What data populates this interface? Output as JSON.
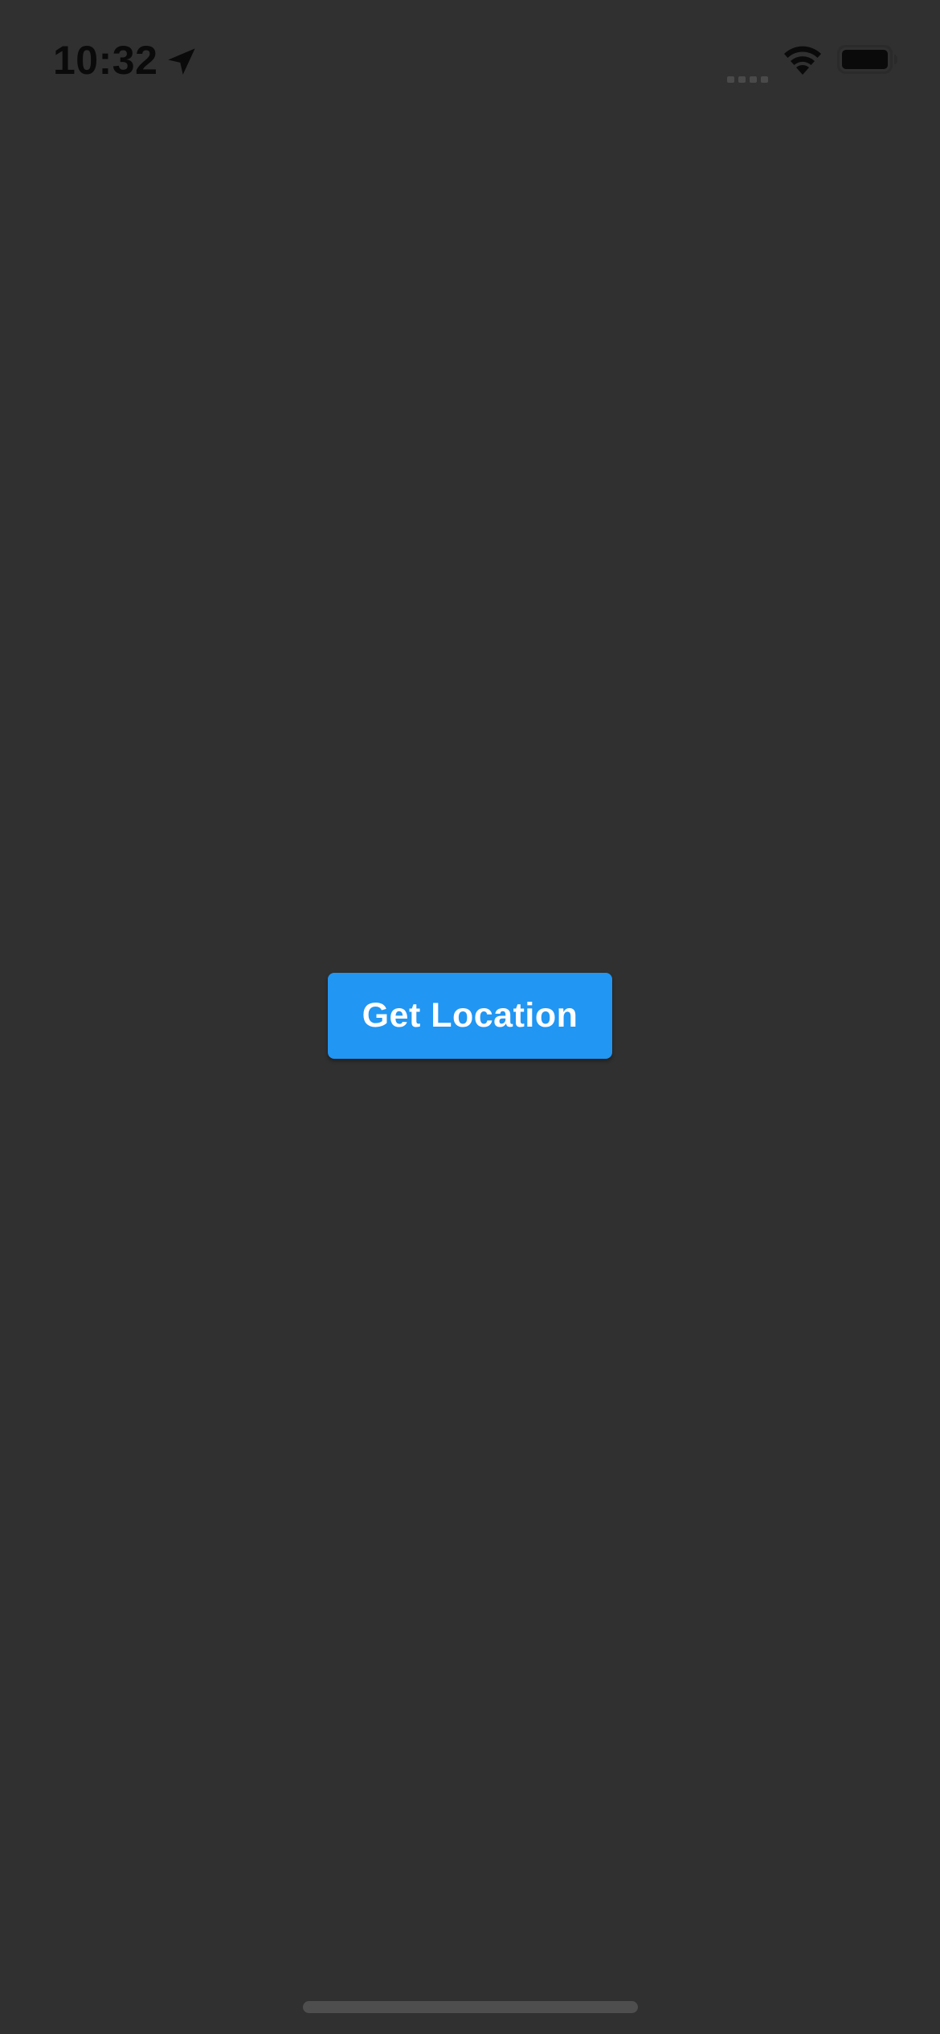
{
  "status_bar": {
    "time": "10:32",
    "location_icon": "location-arrow-icon",
    "signal_icon": "cellular-signal-icon",
    "wifi_icon": "wifi-icon",
    "battery_icon": "battery-icon"
  },
  "main": {
    "button_label": "Get Location"
  },
  "colors": {
    "background": "#303030",
    "button": "#2196f3",
    "button_text": "#ffffff",
    "status_text": "#0a0a0a",
    "home_indicator": "#4e4e4e"
  }
}
